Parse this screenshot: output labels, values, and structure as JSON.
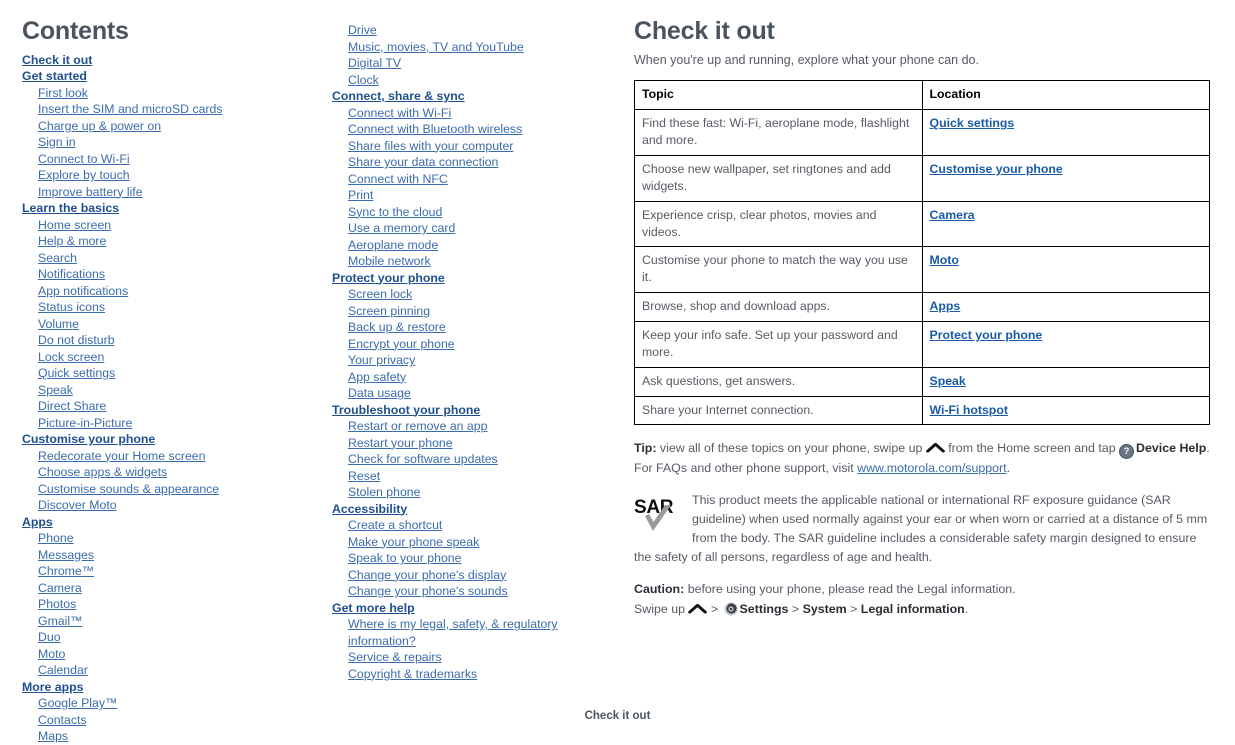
{
  "contents": {
    "title": "Contents",
    "column1": [
      {
        "level": 1,
        "label": "Check it out"
      },
      {
        "level": 1,
        "label": "Get started"
      },
      {
        "level": 2,
        "label": "First look"
      },
      {
        "level": 2,
        "label": "Insert the SIM and microSD cards"
      },
      {
        "level": 2,
        "label": "Charge up & power on"
      },
      {
        "level": 2,
        "label": "Sign in"
      },
      {
        "level": 2,
        "label": "Connect to Wi-Fi"
      },
      {
        "level": 2,
        "label": "Explore by touch"
      },
      {
        "level": 2,
        "label": "Improve battery life"
      },
      {
        "level": 1,
        "label": "Learn the basics"
      },
      {
        "level": 2,
        "label": "Home screen"
      },
      {
        "level": 2,
        "label": "Help & more"
      },
      {
        "level": 2,
        "label": "Search"
      },
      {
        "level": 2,
        "label": "Notifications"
      },
      {
        "level": 2,
        "label": "App notifications"
      },
      {
        "level": 2,
        "label": "Status icons"
      },
      {
        "level": 2,
        "label": "Volume"
      },
      {
        "level": 2,
        "label": "Do not disturb"
      },
      {
        "level": 2,
        "label": "Lock screen"
      },
      {
        "level": 2,
        "label": "Quick settings"
      },
      {
        "level": 2,
        "label": "Speak"
      },
      {
        "level": 2,
        "label": "Direct Share"
      },
      {
        "level": 2,
        "label": "Picture-in-Picture"
      },
      {
        "level": 1,
        "label": "Customise your phone"
      },
      {
        "level": 2,
        "label": "Redecorate your Home screen"
      },
      {
        "level": 2,
        "label": "Choose apps & widgets"
      },
      {
        "level": 2,
        "label": "Customise sounds & appearance"
      },
      {
        "level": 2,
        "label": "Discover Moto"
      },
      {
        "level": 1,
        "label": "Apps"
      },
      {
        "level": 2,
        "label": "Phone"
      },
      {
        "level": 2,
        "label": "Messages"
      },
      {
        "level": 2,
        "label": "Chrome™"
      },
      {
        "level": 2,
        "label": "Camera"
      },
      {
        "level": 2,
        "label": "Photos"
      },
      {
        "level": 2,
        "label": "Gmail™"
      },
      {
        "level": 2,
        "label": "Duo"
      },
      {
        "level": 2,
        "label": "Moto"
      },
      {
        "level": 2,
        "label": "Calendar"
      },
      {
        "level": 1,
        "label": "More apps"
      },
      {
        "level": 2,
        "label": "Google Play™"
      },
      {
        "level": 2,
        "label": "Contacts"
      },
      {
        "level": 2,
        "label": "Maps"
      }
    ],
    "column2": [
      {
        "level": 2,
        "label": "Drive"
      },
      {
        "level": 2,
        "label": "Music, movies, TV and YouTube"
      },
      {
        "level": 2,
        "label": "Digital TV"
      },
      {
        "level": 2,
        "label": "Clock"
      },
      {
        "level": 1,
        "label": "Connect, share & sync"
      },
      {
        "level": 2,
        "label": "Connect with Wi-Fi"
      },
      {
        "level": 2,
        "label": "Connect with Bluetooth wireless"
      },
      {
        "level": 2,
        "label": "Share files with your computer"
      },
      {
        "level": 2,
        "label": "Share your data connection"
      },
      {
        "level": 2,
        "label": "Connect with NFC"
      },
      {
        "level": 2,
        "label": "Print"
      },
      {
        "level": 2,
        "label": "Sync to the cloud"
      },
      {
        "level": 2,
        "label": "Use a memory card"
      },
      {
        "level": 2,
        "label": "Aeroplane mode"
      },
      {
        "level": 2,
        "label": "Mobile network"
      },
      {
        "level": 1,
        "label": "Protect your phone"
      },
      {
        "level": 2,
        "label": "Screen lock"
      },
      {
        "level": 2,
        "label": "Screen pinning"
      },
      {
        "level": 2,
        "label": "Back up & restore"
      },
      {
        "level": 2,
        "label": "Encrypt your phone"
      },
      {
        "level": 2,
        "label": "Your privacy"
      },
      {
        "level": 2,
        "label": "App safety"
      },
      {
        "level": 2,
        "label": "Data usage"
      },
      {
        "level": 1,
        "label": "Troubleshoot your phone"
      },
      {
        "level": 2,
        "label": "Restart or remove an app"
      },
      {
        "level": 2,
        "label": "Restart your phone"
      },
      {
        "level": 2,
        "label": "Check for software updates"
      },
      {
        "level": 2,
        "label": "Reset"
      },
      {
        "level": 2,
        "label": "Stolen phone"
      },
      {
        "level": 1,
        "label": "Accessibility"
      },
      {
        "level": 2,
        "label": "Create a shortcut"
      },
      {
        "level": 2,
        "label": "Make your phone speak"
      },
      {
        "level": 2,
        "label": "Speak to your phone"
      },
      {
        "level": 2,
        "label": "Change your phone's display"
      },
      {
        "level": 2,
        "label": "Change your phone's sounds"
      },
      {
        "level": 1,
        "label": "Get more help"
      },
      {
        "level": 2,
        "label": "Where is my legal, safety, & regulatory information?",
        "wrap": true
      },
      {
        "level": 2,
        "label": "Service & repairs"
      },
      {
        "level": 2,
        "label": "Copyright & trademarks"
      }
    ]
  },
  "main": {
    "title": "Check it out",
    "intro": "When you're up and running, explore what your phone can do.",
    "table": {
      "headers": [
        "Topic",
        "Location"
      ],
      "rows": [
        {
          "topic": "Find these fast: Wi-Fi, aeroplane mode, flashlight and more.",
          "location": "Quick settings"
        },
        {
          "topic": "Choose new wallpaper, set ringtones and add widgets.",
          "location": "Customise your phone"
        },
        {
          "topic": "Experience crisp, clear photos, movies and videos.",
          "location": "Camera"
        },
        {
          "topic": "Customise your phone to match the way you use it.",
          "location": "Moto"
        },
        {
          "topic": "Browse, shop and download apps.",
          "location": "Apps"
        },
        {
          "topic": "Keep your info safe. Set up your password and more.",
          "location": "Protect your phone"
        },
        {
          "topic": "Ask questions, get answers.",
          "location": "Speak"
        },
        {
          "topic": "Share your Internet connection.",
          "location": "Wi-Fi hotspot"
        }
      ]
    },
    "tip": {
      "label": "Tip:",
      "text_before_chevron": " view all of these topics on your phone, swipe up ",
      "text_after_chevron": " from the Home screen and tap ",
      "device_help_label": "Device Help",
      "text_after_help": ". For FAQs and other phone support, visit ",
      "link": "www.motorola.com/support",
      "text_end": "."
    },
    "sar": {
      "logo_text": "SAR",
      "body": "This product meets the applicable national or international RF exposure guidance (SAR guideline) when used normally against your ear or when worn or carried at a distance of 5 mm from the body. The SAR guideline includes a considerable safety margin designed to ensure the safety of all persons, regardless of age and health."
    },
    "caution": {
      "label": "Caution:",
      "text": " before using your phone, please read the Legal information.",
      "swipe_label": "Swipe up ",
      "sep1": " > ",
      "settings_label": "Settings",
      "sep2": " > ",
      "system_label": "System",
      "sep3": " > ",
      "legal_label": "Legal information",
      "period": "."
    }
  },
  "footer": {
    "label": "Check it out"
  },
  "icons": {
    "chevron_up": "⌃",
    "help": "?"
  },
  "colors": {
    "link": "#2d63a4",
    "link_bold": "#1a5ba6",
    "heading": "#4b545e",
    "body_text": "#565b63",
    "table_border": "#000000"
  }
}
